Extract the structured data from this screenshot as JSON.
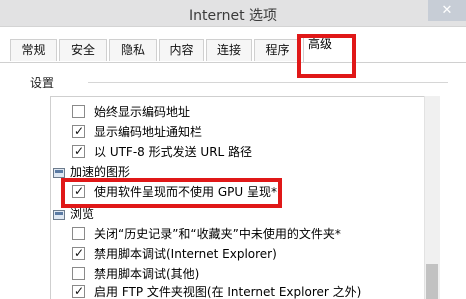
{
  "window": {
    "title": "Internet 选项",
    "close_glyph": "✕"
  },
  "tabs": [
    {
      "label": "常规"
    },
    {
      "label": "安全"
    },
    {
      "label": "隐私"
    },
    {
      "label": "内容"
    },
    {
      "label": "连接"
    },
    {
      "label": "程序"
    },
    {
      "label": "高级",
      "active": true
    }
  ],
  "settings": {
    "group_label": "设置",
    "items": [
      {
        "kind": "checkbox",
        "label": "始终显示编码地址",
        "checked": false
      },
      {
        "kind": "checkbox",
        "label": "显示编码地址通知栏",
        "checked": true
      },
      {
        "kind": "checkbox",
        "label": "以 UTF-8 形式发送 URL 路径",
        "checked": true
      },
      {
        "kind": "category",
        "label": "加速的图形",
        "icon": "graphics-category-icon"
      },
      {
        "kind": "checkbox",
        "label": "使用软件呈现而不使用 GPU 呈现*",
        "checked": true,
        "highlighted": true
      },
      {
        "kind": "category",
        "label": "浏览",
        "icon": "browsing-category-icon"
      },
      {
        "kind": "checkbox",
        "label": "关闭“历史记录”和“收藏夹”中未使用的文件夹*",
        "checked": false
      },
      {
        "kind": "checkbox",
        "label": "禁用脚本调试(Internet Explorer)",
        "checked": true
      },
      {
        "kind": "checkbox",
        "label": "禁用脚本调试(其他)",
        "checked": false
      },
      {
        "kind": "checkbox",
        "label": "启用 FTP 文件夹视图(在 Internet Explorer 之外)",
        "checked": true
      }
    ]
  },
  "colors": {
    "highlight_box": "#e01818",
    "title_bar": "#e2e2e3"
  }
}
